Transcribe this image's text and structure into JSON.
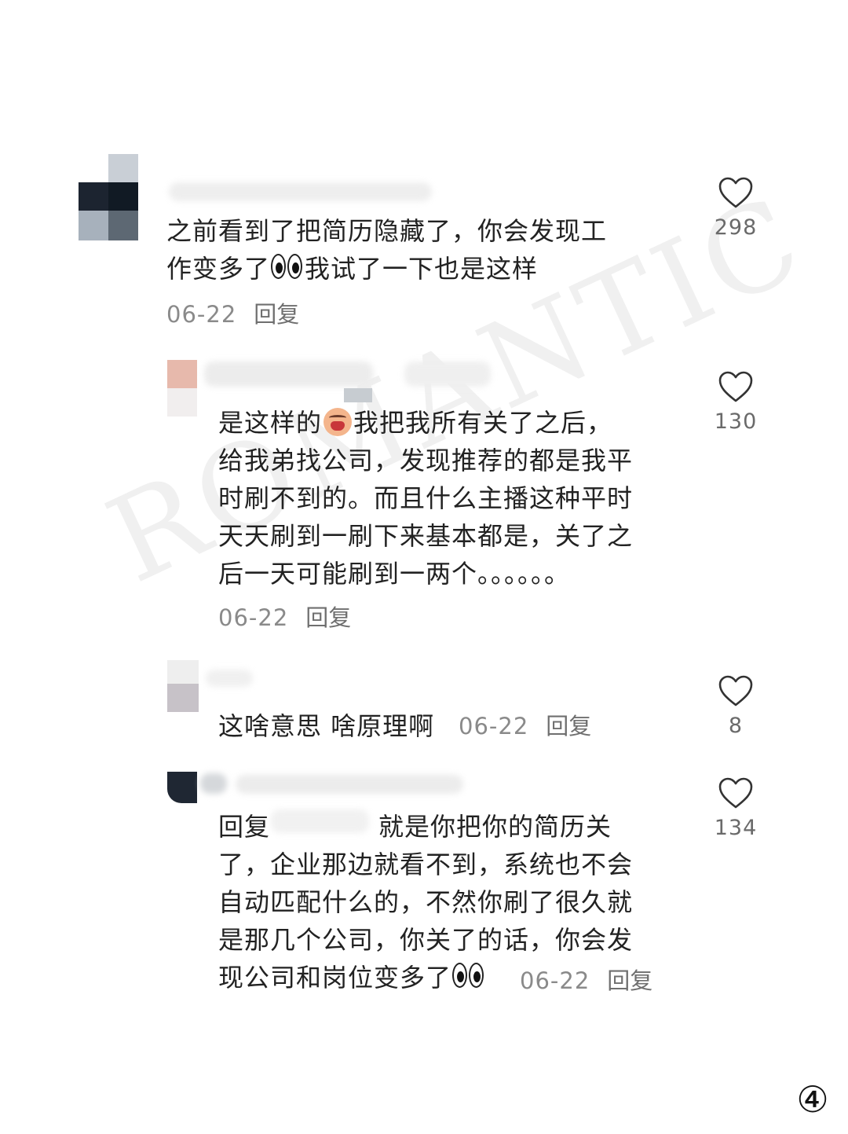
{
  "watermark": "ROMANTIC",
  "page_number": "④",
  "comments": [
    {
      "lines": [
        "之前看到了把简历隐藏了，你会发现工",
        "作变多了",
        "我试了一下也是这样"
      ],
      "date": "06-22",
      "reply_label": "回复",
      "likes": "298",
      "emoji": "eyes-emoji"
    },
    {
      "lines": [
        "是这样的",
        "我把我所有关了之后，",
        "给我弟找公司，发现推荐的都是我平",
        "时刷不到的。而且什么主播这种平时",
        "天天刷到一刷下来基本都是，关了之",
        "后一天可能刷到一两个。。。。。。"
      ],
      "date": "06-22",
      "reply_label": "回复",
      "likes": "130",
      "emoji": "crying-face-emoji"
    },
    {
      "lines": [
        "这啥意思 啥原理啊"
      ],
      "date": "06-22",
      "reply_label": "回复",
      "likes": "8"
    },
    {
      "lines": [
        "回复",
        "就是你把你的简历关",
        "了，企业那边就看不到，系统也不会",
        "自动匹配什么的，不然你刷了很久就",
        "是那几个公司，你关了的话，你会发",
        "现公司和岗位变多了"
      ],
      "date": "06-22",
      "reply_label": "回复",
      "likes": "134",
      "emoji": "eyes-emoji"
    }
  ],
  "colors": {
    "text": "#222222",
    "meta": "#8a8a8a",
    "heart_outline": "#333333"
  }
}
